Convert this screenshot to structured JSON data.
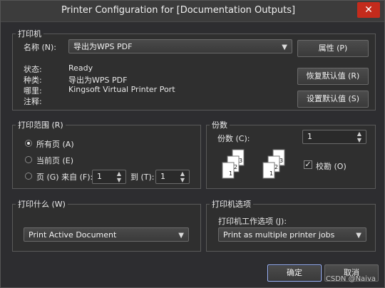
{
  "window": {
    "title": "Printer Configuration for [Documentation Outputs]",
    "close_glyph": "✕"
  },
  "printer_group": {
    "legend": "打印机",
    "name_label": "名称 (N):",
    "printer_select_value": "导出为WPS PDF",
    "status_label": "状态:",
    "status_value": "Ready",
    "type_label": "种类:",
    "type_value": "导出为WPS PDF",
    "where_label": "哪里:",
    "where_value": "Kingsoft Virtual Printer Port",
    "comment_label": "注释:",
    "properties_button": "属性 (P)",
    "restore_defaults_button": "恢复默认值 (R)",
    "set_defaults_button": "设置默认值 (S)"
  },
  "print_range": {
    "legend": "打印范围 (R)",
    "all_pages": "所有页 (A)",
    "current_page": "当前页 (E)",
    "pages_label": "页 (G) 来自 (F):",
    "from_value": "1",
    "to_label": "到 (T):",
    "to_value": "1",
    "selected": "all_pages"
  },
  "copies": {
    "legend": "份数",
    "copies_label": "份数 (C):",
    "copies_value": "1",
    "collate_label": "校勘 (O)",
    "collate_checked": true,
    "icon_a": [
      "1",
      "2",
      "3"
    ],
    "icon_b": [
      "1",
      "2",
      "3"
    ]
  },
  "print_what": {
    "legend": "打印什么 (W)",
    "select_value": "Print Active Document"
  },
  "printer_options": {
    "legend": "打印机选项",
    "job_label": "打印机工作选项 (J):",
    "select_value": "Print as multiple printer jobs"
  },
  "footer": {
    "ok_button": "确定",
    "cancel_button": "取消",
    "watermark": "CSDN @Naiva"
  }
}
